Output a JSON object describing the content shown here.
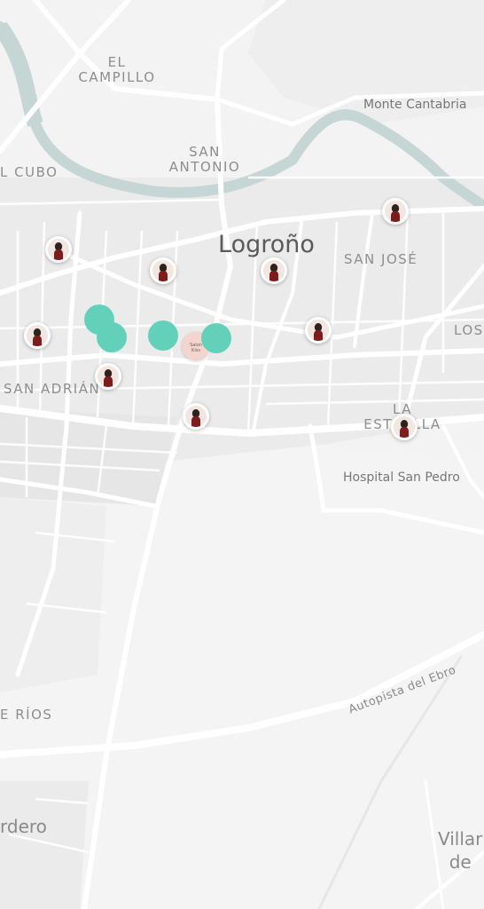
{
  "map": {
    "labels": {
      "el_campillo": "EL\nCAMPILLO",
      "monte_cantabria": "Monte Cantabria",
      "el_cubo": "L CUBO",
      "san_antonio": "SAN\nANTONIO",
      "logrono": "Logroño",
      "san_jose": "SAN JOSÉ",
      "los": "LOS",
      "san_adrian": "SAN ADRIÁN",
      "la_estrella": "LA\nESTRELLA",
      "hospital": "Hospital San Pedro",
      "autopista": "Autopista del Ebro",
      "rios": "E RÍOS",
      "lardero": "rdero",
      "villamediana": "Villar\nde"
    },
    "pins": [
      {
        "name": "profile-pin-1",
        "kind": "avatar"
      },
      {
        "name": "profile-pin-2",
        "kind": "avatar"
      },
      {
        "name": "profile-pin-3",
        "kind": "avatar"
      },
      {
        "name": "profile-pin-4",
        "kind": "avatar"
      },
      {
        "name": "profile-pin-5",
        "kind": "avatar"
      },
      {
        "name": "profile-pin-6",
        "kind": "avatar"
      },
      {
        "name": "profile-pin-7",
        "kind": "avatar"
      },
      {
        "name": "profile-pin-8",
        "kind": "avatar"
      },
      {
        "name": "profile-pin-9",
        "kind": "avatar"
      }
    ],
    "pale_pin_text": "Salon Kiss",
    "cluster_dots_count": 5,
    "colors": {
      "background": "#f3f3f3",
      "road": "#ffffff",
      "river": "#c4d4d2",
      "block": "#ebebeb",
      "marker": "#63d1ba",
      "city_label": "#5a5a5a",
      "district_label": "#8e8e8e"
    }
  }
}
